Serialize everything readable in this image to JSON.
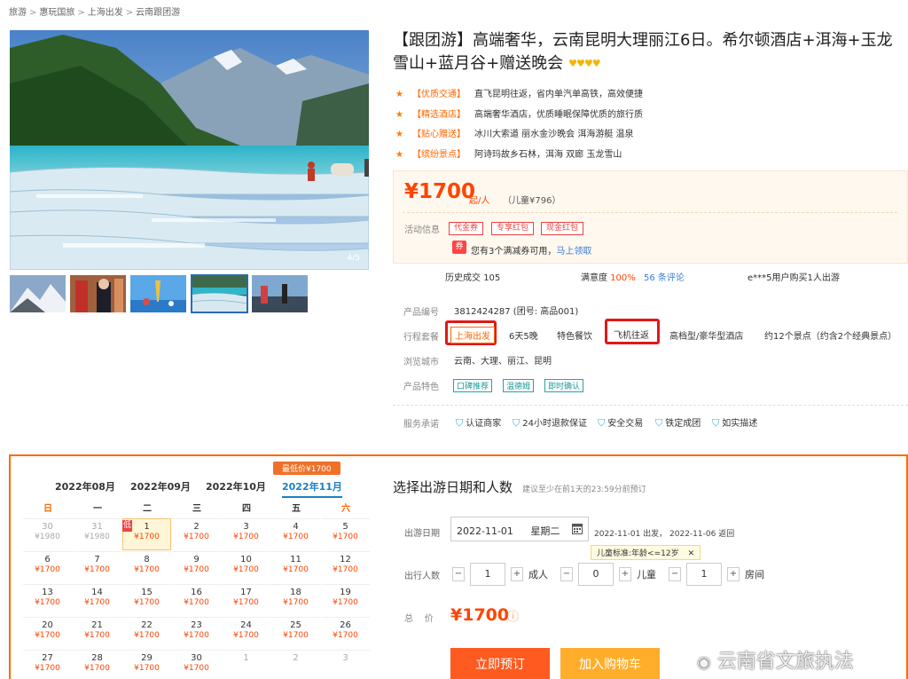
{
  "breadcrumb": [
    "旅游",
    "惠玩国旅",
    "上海出发",
    "云南跟团游"
  ],
  "gallery": {
    "index": "4/5"
  },
  "product": {
    "title": "【跟团游】高端奢华，云南昆明大理丽江6日。希尔顿酒店+洱海+玉龙雪山+蓝月谷+赠送晚会",
    "stars": "♥♥♥♥",
    "features": [
      {
        "tag": "【优质交通】",
        "text": "直飞昆明往返，省内单汽单高铁，高效便捷"
      },
      {
        "tag": "【精选酒店】",
        "text": "高端奢华酒店，优质睡眠保障优质的旅行质"
      },
      {
        "tag": "【贴心赠送】",
        "text": "冰川大索道 丽水金沙晚会 洱海游艇 温泉"
      },
      {
        "tag": "【缤纷景点】",
        "text": "阿诗玛故乡石林，洱海 双廊 玉龙雪山"
      }
    ]
  },
  "price": {
    "amount": "¥1700",
    "unit": "起/人",
    "child": "（儿童¥796）",
    "promo_label": "活动信息",
    "coupons": [
      "代金券",
      "专享红包",
      "现金红包"
    ],
    "coupon_icon": "券",
    "coupon_text": "您有3个满减券可用，",
    "coupon_link": "马上领取"
  },
  "stats": {
    "history_label": "历史成交",
    "history": "105",
    "satisfaction_label": "满意度",
    "satisfaction": "100%",
    "reviews": "56 条评论",
    "recent": "e***5用户购买1人出游"
  },
  "info": {
    "code_label": "产品编号",
    "code": "3812424287 (团号: 高品001)",
    "package_label": "行程套餐",
    "packages": [
      "上海出发",
      "6天5晚",
      "特色餐饮",
      "飞机往返",
      "高档型/豪华型酒店",
      "约12个景点（约含2个经典景点）"
    ],
    "cities_label": "浏览城市",
    "cities": "云南、大理、丽江、昆明",
    "feature_label": "产品特色",
    "feature_tags": [
      "口碑推荐",
      "温德姆",
      "即时确认"
    ],
    "service_label": "服务承诺",
    "services": [
      "认证商家",
      "24小时退款保证",
      "安全交易",
      "铁定成团",
      "如实描述"
    ]
  },
  "calendar": {
    "lowest_badge": "最低价¥1700",
    "months": [
      "2022年08月",
      "2022年09月",
      "2022年10月",
      "2022年11月"
    ],
    "weekdays": [
      "日",
      "一",
      "二",
      "三",
      "四",
      "五",
      "六"
    ],
    "low_tag": "低",
    "cells": [
      {
        "d": "30",
        "p": "¥1980",
        "o": true
      },
      {
        "d": "31",
        "p": "¥1980",
        "o": true
      },
      {
        "d": "1",
        "p": "¥1700",
        "sel": true,
        "low": true
      },
      {
        "d": "2",
        "p": "¥1700"
      },
      {
        "d": "3",
        "p": "¥1700"
      },
      {
        "d": "4",
        "p": "¥1700"
      },
      {
        "d": "5",
        "p": "¥1700"
      },
      {
        "d": "6",
        "p": "¥1700"
      },
      {
        "d": "7",
        "p": "¥1700"
      },
      {
        "d": "8",
        "p": "¥1700"
      },
      {
        "d": "9",
        "p": "¥1700"
      },
      {
        "d": "10",
        "p": "¥1700"
      },
      {
        "d": "11",
        "p": "¥1700"
      },
      {
        "d": "12",
        "p": "¥1700"
      },
      {
        "d": "13",
        "p": "¥1700"
      },
      {
        "d": "14",
        "p": "¥1700"
      },
      {
        "d": "15",
        "p": "¥1700"
      },
      {
        "d": "16",
        "p": "¥1700"
      },
      {
        "d": "17",
        "p": "¥1700"
      },
      {
        "d": "18",
        "p": "¥1700"
      },
      {
        "d": "19",
        "p": "¥1700"
      },
      {
        "d": "20",
        "p": "¥1700"
      },
      {
        "d": "21",
        "p": "¥1700"
      },
      {
        "d": "22",
        "p": "¥1700"
      },
      {
        "d": "23",
        "p": "¥1700"
      },
      {
        "d": "24",
        "p": "¥1700"
      },
      {
        "d": "25",
        "p": "¥1700"
      },
      {
        "d": "26",
        "p": "¥1700"
      },
      {
        "d": "27",
        "p": "¥1700"
      },
      {
        "d": "28",
        "p": "¥1700"
      },
      {
        "d": "29",
        "p": "¥1700"
      },
      {
        "d": "30",
        "p": "¥1700"
      },
      {
        "d": "1",
        "p": "",
        "o": true
      },
      {
        "d": "2",
        "p": "",
        "o": true
      },
      {
        "d": "3",
        "p": "",
        "o": true
      }
    ]
  },
  "booking": {
    "title": "选择出游日期和人数",
    "note": "建议至少在前1天的23:59分前预订",
    "date_label": "出游日期",
    "date": "2022-11-01",
    "weekday": "星期二",
    "date_info": "2022-11-01 出发，  2022-11-06 返回",
    "child_tip": "儿童标准:年龄<=12岁",
    "child_tip_close": "✕",
    "people_label": "出行人数",
    "adults": "1",
    "adult_unit": "成人",
    "children": "0",
    "child_unit": "儿童",
    "rooms": "1",
    "room_unit": "房间",
    "minus": "−",
    "plus": "+",
    "total_label": "总    价",
    "total": "¥1700",
    "info_icon": "ⓘ",
    "book_label": "立即预订",
    "cart_label": "加入购物车"
  },
  "watermark": "云南省文旅执法"
}
